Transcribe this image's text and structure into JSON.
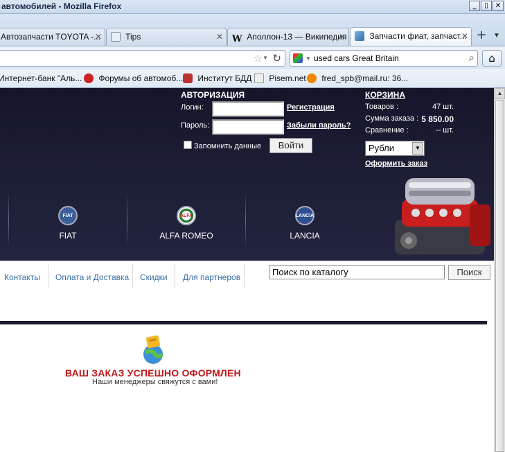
{
  "window": {
    "title": "автомобилей - Mozilla Firefox",
    "buttons": [
      "_",
      "▯",
      "✕"
    ]
  },
  "tabs": [
    {
      "label": "Автозапчасти TOYOTA -...",
      "active": false
    },
    {
      "label": "Tips",
      "active": false
    },
    {
      "label": "Аполлон-13 — Википедия",
      "active": false,
      "icon_text": "W"
    },
    {
      "label": "Запчасти фиат, запчаст...",
      "active": true
    }
  ],
  "newtab_label": "+",
  "search": {
    "value": "used cars Great Britain"
  },
  "bookmarks": [
    {
      "label": "Интернет-банк \"Аль...",
      "color": "#d33"
    },
    {
      "label": "Форумы об автомоб...",
      "color": "#c22"
    },
    {
      "label": "Институт БДД",
      "color": "#b33"
    },
    {
      "label": "Pisem.net",
      "color": "#999"
    },
    {
      "label": "fred_spb@mail.ru: 36...",
      "color": "#e80"
    }
  ],
  "auth": {
    "title": "АВТОРИЗАЦИЯ",
    "login_label": "Логин:",
    "password_label": "Пароль:",
    "register_link": "Регистрация",
    "forgot_link": "Забыли пароль?",
    "remember_label": "Запомнить данные",
    "login_button": "Войти"
  },
  "cart": {
    "title": "КОРЗИНА",
    "rows": [
      {
        "label": "Товаров :",
        "value": "47 шт."
      },
      {
        "label": "Сумма заказа :",
        "value": "5 850.00"
      },
      {
        "label": "Сравнение :",
        "value": "-- шт."
      }
    ],
    "currency": "Рубли",
    "checkout_link": "Оформить заказ"
  },
  "brands": [
    {
      "name": "FIAT",
      "logo_text": "FIAT"
    },
    {
      "name": "ALFA ROMEO",
      "logo_text": "ALFA"
    },
    {
      "name": "LANCIA",
      "logo_text": "LANCIA"
    }
  ],
  "menu": [
    "Контакты",
    "Оплата и Доставка",
    "Скидки",
    "Для партнеров"
  ],
  "catalog_search": {
    "value": "Поиск по каталогу",
    "button": "Поиск"
  },
  "success": {
    "title": "ВАШ ЗАКАЗ УСПЕШНО ОФОРМЛЕН",
    "subtitle": "Наши менеджеры свяжутся с вами!"
  },
  "colors": {
    "banner": "#1e2038",
    "success": "#c01818",
    "menu_link": "#3a6fa6"
  }
}
